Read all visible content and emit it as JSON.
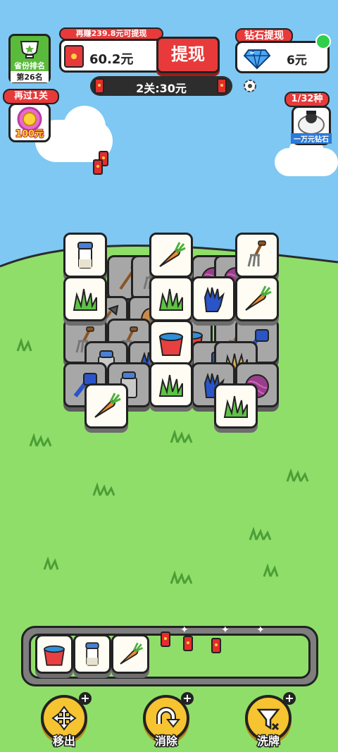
{
  "province_rank": {
    "title": "省份排名",
    "rank": "第26名"
  },
  "earn_more": {
    "hint": "再赚239.8元可提现",
    "amount": "60.2元",
    "withdraw_label": "提现"
  },
  "diamond": {
    "title": "钻石提现",
    "value": "6元"
  },
  "level": {
    "text": "2关:30元"
  },
  "pass_one": {
    "title": "再过1关",
    "reward": "100元"
  },
  "collection": {
    "count": "1/32种",
    "caption": "一万元钻石"
  },
  "actions": [
    {
      "label": "移出"
    },
    {
      "label": "消除"
    },
    {
      "label": "洗牌"
    }
  ],
  "colors": {
    "sky": "#7ec8f3",
    "grass": "#8fde6a",
    "accent_red": "#e83a3a",
    "button_yellow": "#f6c331"
  },
  "board_icons": [
    "milk-bottle",
    "carrot",
    "pitchfork",
    "grass",
    "grass",
    "blue-glove",
    "carrot",
    "red-bucket",
    "grass",
    "carrot",
    "grass",
    "purple-yarn",
    "blue-brush",
    "milk-jug",
    "hay",
    "shovel",
    "potato"
  ],
  "slot_icons": [
    "red-bucket",
    "milk-bottle",
    "carrot"
  ]
}
